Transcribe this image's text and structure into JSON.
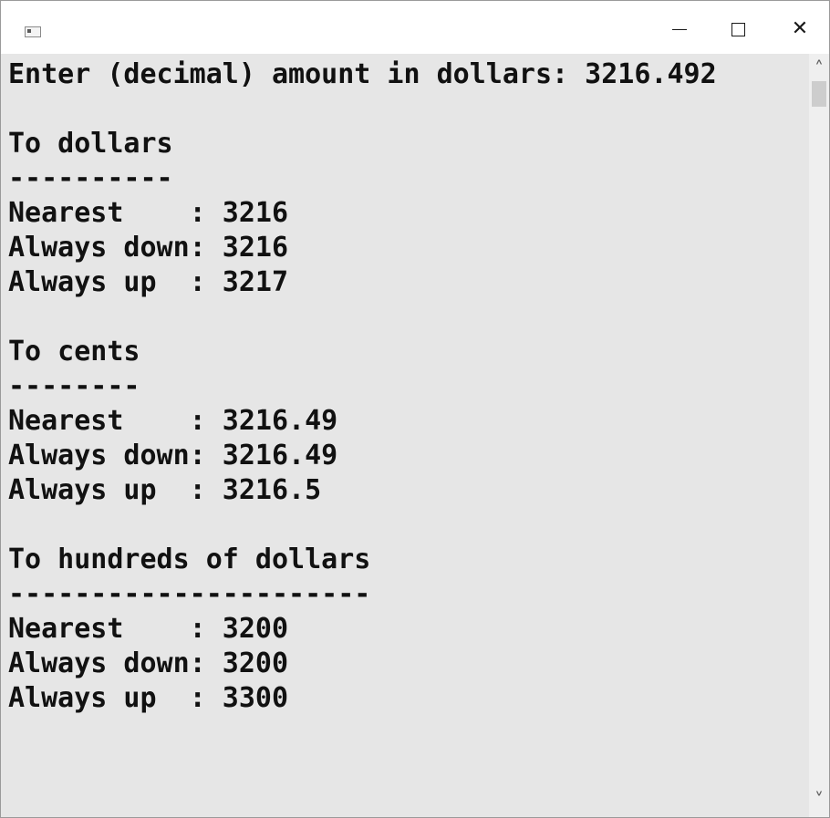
{
  "window": {
    "minimize_icon": "minimize-icon",
    "maximize_icon": "maximize-icon",
    "close_symbol": "✕"
  },
  "console": {
    "lines": [
      "Enter (decimal) amount in dollars: 3216.492",
      "",
      "To dollars",
      "----------",
      "Nearest    : 3216",
      "Always down: 3216",
      "Always up  : 3217",
      "",
      "To cents",
      "--------",
      "Nearest    : 3216.49",
      "Always down: 3216.49",
      "Always up  : 3216.5",
      "",
      "To hundreds of dollars",
      "----------------------",
      "Nearest    : 3200",
      "Always down: 3200",
      "Always up  : 3300"
    ]
  },
  "scrollbar": {
    "up_symbol": "˄",
    "down_symbol": "˅"
  },
  "colors": {
    "console_background": "#e6e6e6",
    "console_text": "#111111",
    "titlebar": "#ffffff"
  }
}
